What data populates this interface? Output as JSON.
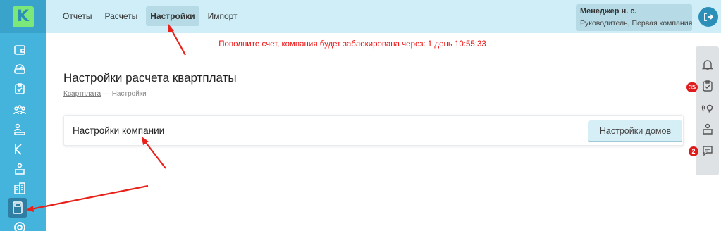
{
  "logo": {
    "letter": "K"
  },
  "nav": {
    "items": [
      {
        "label": "Отчеты",
        "active": false
      },
      {
        "label": "Расчеты",
        "active": false
      },
      {
        "label": "Настройки",
        "active": true
      },
      {
        "label": "Импорт",
        "active": false
      }
    ]
  },
  "user": {
    "name": "Менеджер н. с.",
    "role": "Руководитель, Первая компания"
  },
  "warning": "Пополните счет, компания будет заблокирована через: 1 день 10:55:33",
  "page": {
    "title": "Настройки расчета квартплаты",
    "breadcrumb": {
      "link": "Квартплата",
      "separator": " — ",
      "current": "Настройки"
    }
  },
  "card": {
    "title": "Настройки компании",
    "button": "Настройки домов"
  },
  "right_panel": {
    "tasks_badge": "35",
    "messages_badge": "2"
  },
  "sidebar_icons": [
    "wallet-icon",
    "meter-icon",
    "clipboard-icon",
    "people-icon",
    "users-list-icon",
    "brand-k-icon",
    "operator-icon",
    "buildings-icon",
    "calculator-icon",
    "email-icon"
  ],
  "colors": {
    "sidebar": "#44b4dd",
    "topbar": "#cfeef7",
    "warning": "#ee1111",
    "badge": "#e01b1b",
    "arrow": "#e8221a"
  }
}
